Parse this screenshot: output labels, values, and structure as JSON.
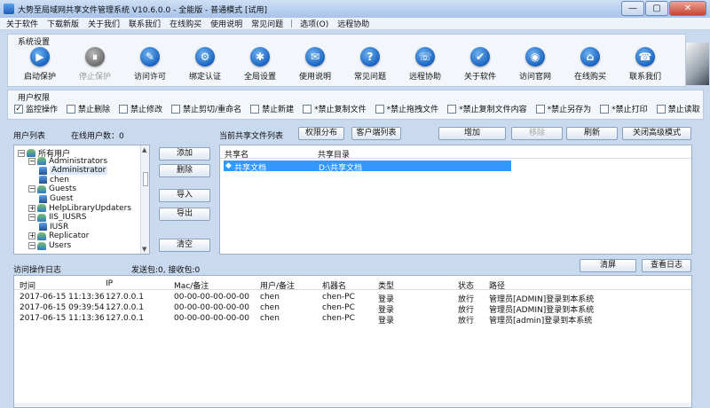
{
  "window": {
    "title": "大势至局域网共享文件管理系统 V10.6.0.0 - 全能版 - 普通模式 [试用]",
    "controls": [
      "—",
      "▢",
      "✕"
    ]
  },
  "menu": [
    "关于软件",
    "下载新版",
    "关于我们",
    "联系我们",
    "在线购买",
    "使用说明",
    "常见问题",
    "|",
    "选项(O)",
    "远程协助"
  ],
  "system_settings": {
    "title": "系统设置",
    "buttons": [
      {
        "label": "启动保护",
        "icon": "play-icon",
        "glyph": "▶",
        "enabled": true
      },
      {
        "label": "停止保护",
        "icon": "pause-icon",
        "glyph": "⏸",
        "enabled": false
      },
      {
        "label": "访问许可",
        "icon": "permit-icon",
        "glyph": "✎",
        "enabled": true
      },
      {
        "label": "绑定认证",
        "icon": "bind-icon",
        "glyph": "⚙",
        "enabled": true
      },
      {
        "label": "全局设置",
        "icon": "gear-icon",
        "glyph": "✱",
        "enabled": true
      },
      {
        "label": "使用说明",
        "icon": "help-book-icon",
        "glyph": "✉",
        "enabled": true
      },
      {
        "label": "常见问题",
        "icon": "question-icon",
        "glyph": "?",
        "enabled": true
      },
      {
        "label": "远程协助",
        "icon": "remote-icon",
        "glyph": "☏",
        "enabled": true
      },
      {
        "label": "关于软件",
        "icon": "about-icon",
        "glyph": "✔",
        "enabled": true
      },
      {
        "label": "访问官网",
        "icon": "website-icon",
        "glyph": "◉",
        "enabled": true
      },
      {
        "label": "在线购买",
        "icon": "cart-icon",
        "glyph": "⌂",
        "enabled": true
      },
      {
        "label": "联系我们",
        "icon": "contact-icon",
        "glyph": "☎",
        "enabled": true
      }
    ]
  },
  "user_permissions": {
    "title": "用户权限",
    "options": [
      {
        "label": "监控操作",
        "checked": true
      },
      {
        "label": "禁止删除",
        "checked": false
      },
      {
        "label": "禁止修改",
        "checked": false
      },
      {
        "label": "禁止剪切/重命名",
        "checked": false
      },
      {
        "label": "禁止新建",
        "checked": false
      },
      {
        "label": "*禁止复制文件",
        "checked": false
      },
      {
        "label": "*禁止拖拽文件",
        "checked": false
      },
      {
        "label": "*禁止复制文件内容",
        "checked": false
      },
      {
        "label": "*禁止另存为",
        "checked": false
      },
      {
        "label": "*禁止打印",
        "checked": false
      },
      {
        "label": "禁止读取",
        "checked": false
      }
    ]
  },
  "users": {
    "title": "用户列表",
    "online_label": "在线用户数：0",
    "tree": [
      {
        "label": "所有用户",
        "depth": 0,
        "type": "group",
        "expanded": true
      },
      {
        "label": "Administrators",
        "depth": 1,
        "type": "group",
        "expanded": true
      },
      {
        "label": "Administrator",
        "depth": 2,
        "type": "user",
        "selected": true
      },
      {
        "label": "chen",
        "depth": 2,
        "type": "user"
      },
      {
        "label": "Guests",
        "depth": 1,
        "type": "group",
        "expanded": true
      },
      {
        "label": "Guest",
        "depth": 2,
        "type": "user"
      },
      {
        "label": "HelpLibraryUpdaters",
        "depth": 1,
        "type": "group"
      },
      {
        "label": "IIS_IUSRS",
        "depth": 1,
        "type": "group",
        "expanded": true
      },
      {
        "label": "IUSR",
        "depth": 2,
        "type": "user"
      },
      {
        "label": "Replicator",
        "depth": 1,
        "type": "group"
      },
      {
        "label": "Users",
        "depth": 1,
        "type": "group",
        "expanded": true
      }
    ],
    "buttons": {
      "add": "添加",
      "delete": "删除",
      "import": "导入",
      "export": "导出",
      "clear": "清空"
    }
  },
  "shares": {
    "title": "当前共享文件列表",
    "buttons": {
      "perm_dist": "权限分布",
      "client_list": "客户端列表",
      "add": "增加",
      "remove": "移除",
      "refresh": "刷新",
      "close_adv": "关闭高级模式"
    },
    "columns": [
      "共享名",
      "共享目录"
    ],
    "rows": [
      {
        "name": "共享文档",
        "path": "D:\\共享文档"
      }
    ]
  },
  "log": {
    "title": "访问操作日志",
    "packets": "发送包:0, 接收包:0",
    "buttons": {
      "clear": "清屏",
      "view": "查看日志"
    },
    "columns": [
      "时间",
      "IP",
      "Mac/备注",
      "用户/备注",
      "机器名",
      "类型",
      "状态",
      "路径"
    ],
    "rows": [
      [
        "2017-06-15 11:13:36",
        "127.0.0.1",
        "00-00-00-00-00-00",
        "chen",
        "chen-PC",
        "登录",
        "放行",
        "管理员[ADMIN]登录到本系统"
      ],
      [
        "2017-06-15 09:39:54",
        "127.0.0.1",
        "00-00-00-00-00-00",
        "chen",
        "chen-PC",
        "登录",
        "放行",
        "管理员[ADMIN]登录到本系统"
      ],
      [
        "2017-06-15 11:13:36",
        "127.0.0.1",
        "00-00-00-00-00-00",
        "chen",
        "chen-PC",
        "登录",
        "放行",
        "管理员[admin]登录到本系统"
      ]
    ]
  }
}
